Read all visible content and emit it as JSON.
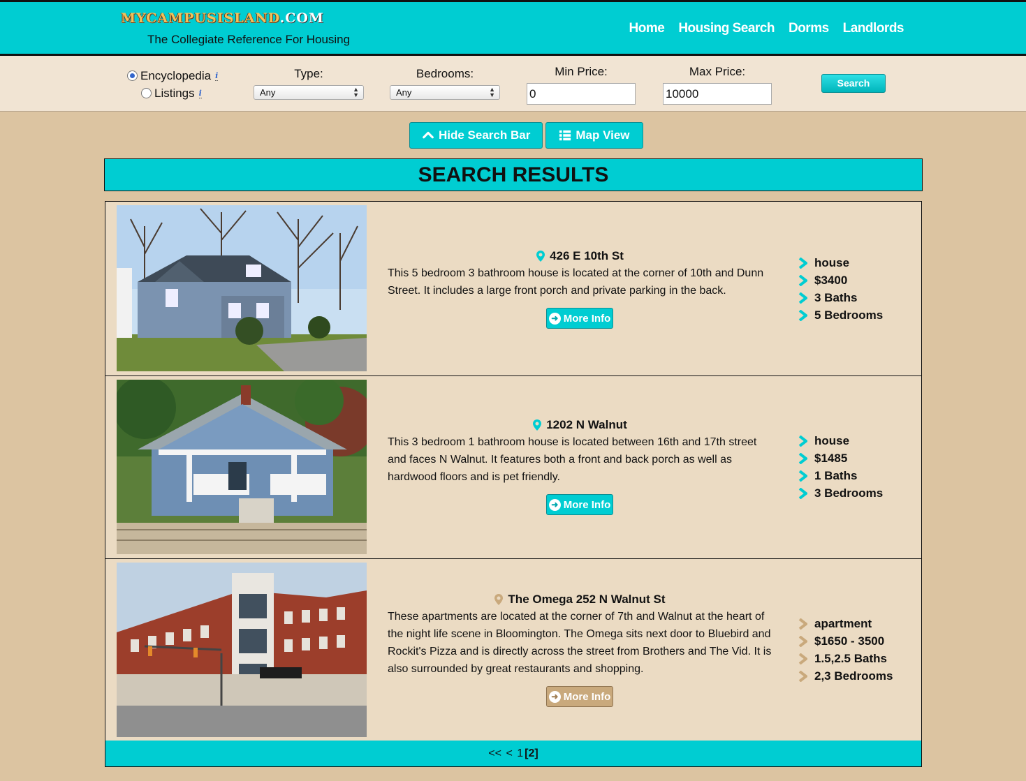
{
  "header": {
    "logo_main": "MYCAMPUSISLAND",
    "logo_suffix": ".COM",
    "tagline": "The Collegiate Reference For Housing",
    "nav": [
      "Home",
      "Housing Search",
      "Dorms",
      "Landlords"
    ]
  },
  "search": {
    "mode_options": [
      "Encyclopedia",
      "Listings"
    ],
    "mode_selected": "Encyclopedia",
    "type_label": "Type:",
    "type_value": "Any",
    "bedrooms_label": "Bedrooms:",
    "bedrooms_value": "Any",
    "min_price_label": "Min Price:",
    "min_price_value": "0",
    "max_price_label": "Max Price:",
    "max_price_value": "10000",
    "search_label": "Search"
  },
  "toggles": {
    "hide_label": "Hide Search Bar",
    "map_label": "Map View"
  },
  "results_title": "SEARCH RESULTS",
  "listings": [
    {
      "address": "426 E 10th St",
      "description": "This 5 bedroom 3 bathroom house is located at the corner of 10th and Dunn Street. It includes a large front porch and private parking in the back.",
      "more_label": "More Info",
      "type": "house",
      "price": "$3400",
      "baths": "3 Baths",
      "bedrooms": "5 Bedrooms",
      "accent": "#00cdd2"
    },
    {
      "address": "1202 N Walnut",
      "description": "This 3 bedroom 1 bathroom house is located between 16th and 17th street and faces N Walnut. It features both a front and back porch as well as hardwood floors and is pet friendly.",
      "more_label": "More Info",
      "type": "house",
      "price": "$1485",
      "baths": "1 Baths",
      "bedrooms": "3 Bedrooms",
      "accent": "#00cdd2"
    },
    {
      "address": "The Omega 252 N Walnut St",
      "description": "These apartments are located at the corner of 7th and Walnut at the heart of the night life scene in Bloomington. The Omega sits next door to Bluebird and Rockit's Pizza and is directly across the street from Brothers and The Vid. It is also surrounded by great restaurants and shopping.",
      "more_label": "More Info",
      "type": "apartment",
      "price": "$1650 - 3500",
      "baths": "1.5,2.5 Baths",
      "bedrooms": "2,3 Bedrooms",
      "accent": "#c9a97c"
    }
  ],
  "pager": {
    "first": "<<",
    "prev": "<",
    "page1": "1",
    "page2": "[2]"
  }
}
